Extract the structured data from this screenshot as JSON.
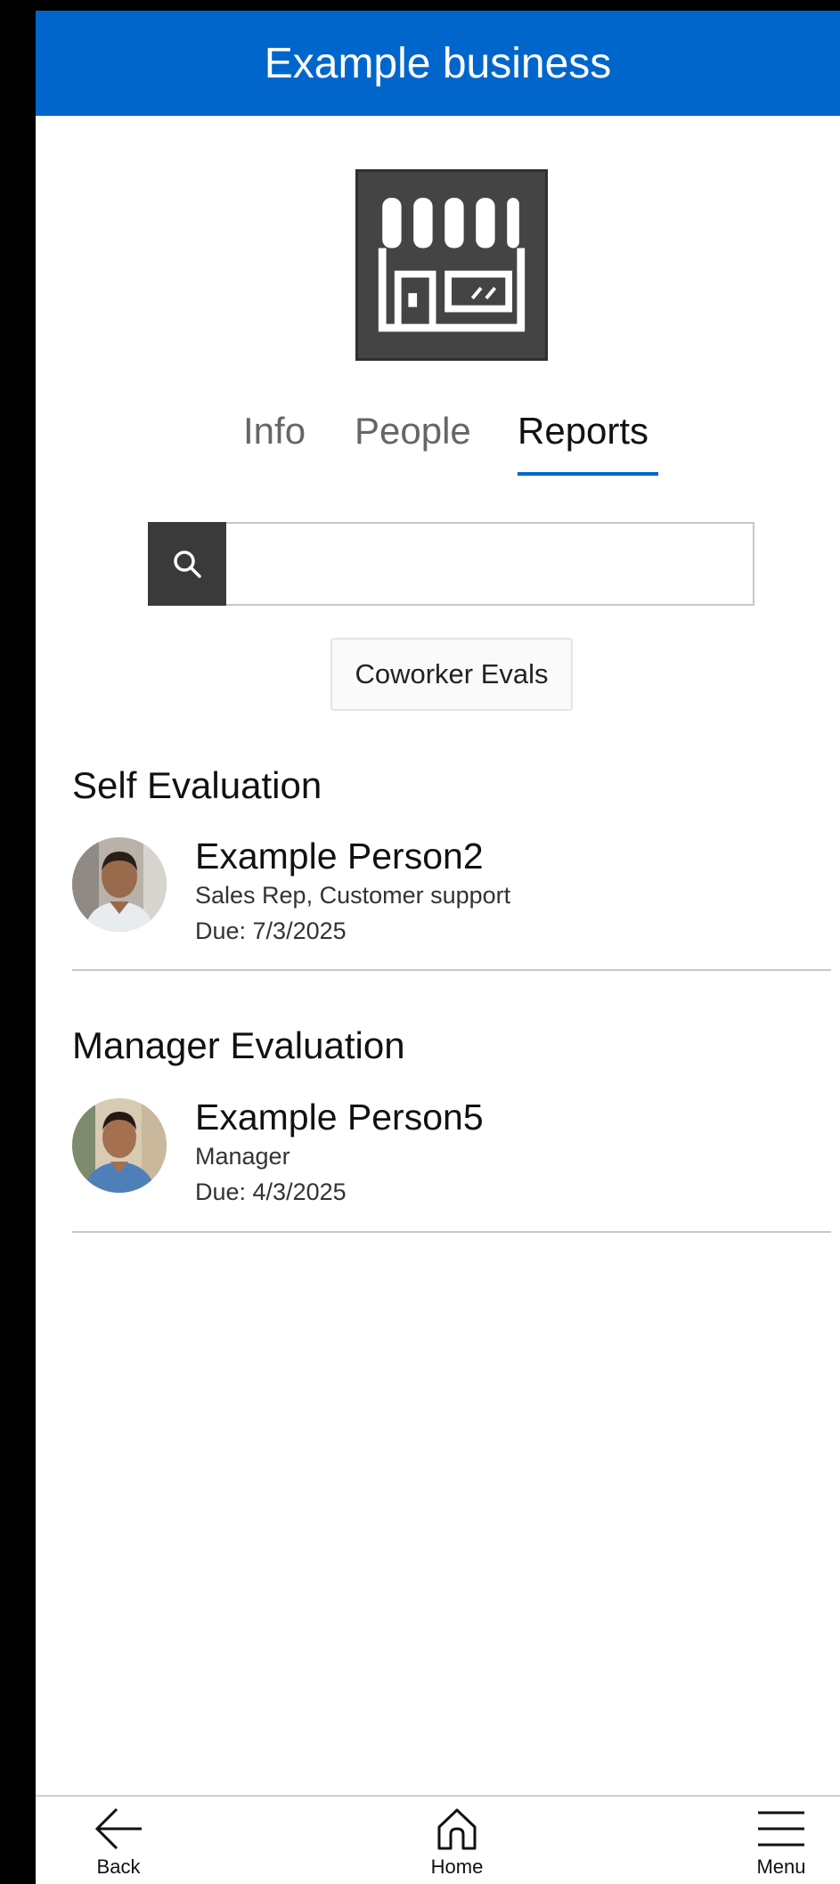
{
  "header": {
    "title": "Example business"
  },
  "logo": {
    "icon": "storefront-icon"
  },
  "tabs": [
    {
      "label": "Info",
      "active": false
    },
    {
      "label": "People",
      "active": false
    },
    {
      "label": "Reports",
      "active": true
    }
  ],
  "search": {
    "value": "",
    "placeholder": "",
    "icon": "search-icon"
  },
  "filter_button": {
    "label": "Coworker Evals"
  },
  "sections": [
    {
      "title": "Self Evaluation",
      "person": {
        "name": "Example Person2",
        "role": "Sales Rep, Customer support",
        "due": "Due: 7/3/2025"
      }
    },
    {
      "title": "Manager Evaluation",
      "person": {
        "name": "Example Person5",
        "role": "Manager",
        "due": "Due: 4/3/2025"
      }
    }
  ],
  "bottom_nav": [
    {
      "label": "Back",
      "icon": "back-arrow-icon"
    },
    {
      "label": "Home",
      "icon": "home-icon"
    },
    {
      "label": "Menu",
      "icon": "hamburger-menu-icon"
    }
  ],
  "colors": {
    "brand": "#0066cc",
    "search_button": "#3a3a3a",
    "logo_bg": "#444444"
  }
}
